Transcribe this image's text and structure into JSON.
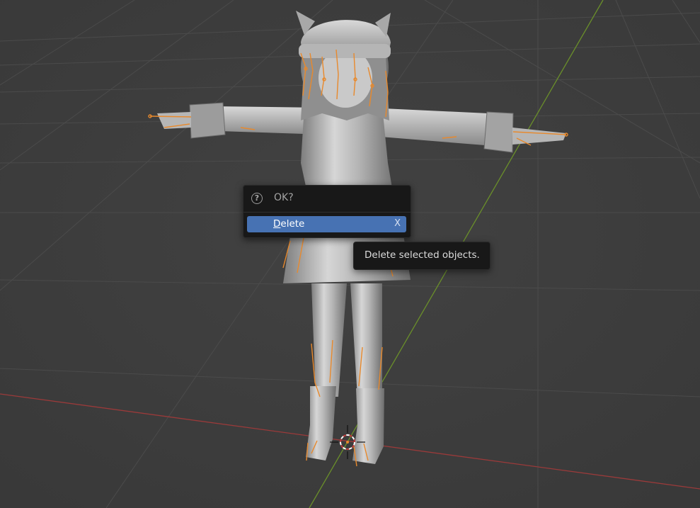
{
  "viewport": {
    "description_icon": "3d-character-model-with-armature",
    "colors": {
      "background": "#3d3d3d",
      "grid": "#4a4a4a",
      "x_axis": "#9a3a3a",
      "y_axis": "#6a8f2a",
      "bones": "#e8892c",
      "mesh": "#bdbdbd"
    },
    "cursor_icon": "3d-cursor-icon"
  },
  "confirm_popup": {
    "icon": "question-icon",
    "icon_glyph": "?",
    "title": "OK?",
    "delete_label_first": "D",
    "delete_label_rest": "elete",
    "shortcut": "X"
  },
  "tooltip": {
    "text": "Delete selected objects."
  }
}
